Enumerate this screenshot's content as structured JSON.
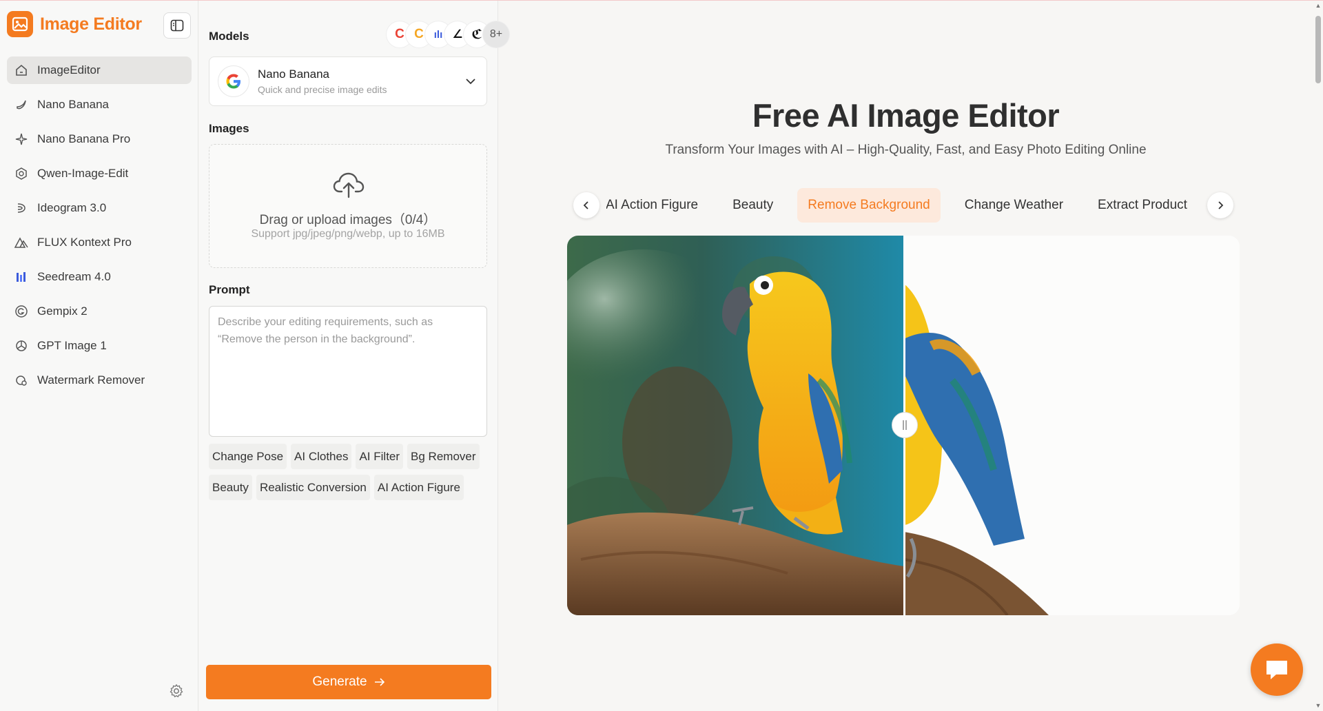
{
  "brand": {
    "title": "Image Editor"
  },
  "sidebar": {
    "items": [
      {
        "label": "ImageEditor",
        "icon": "home-icon",
        "active": true
      },
      {
        "label": "Nano Banana",
        "icon": "banana-icon"
      },
      {
        "label": "Nano Banana Pro",
        "icon": "sparkle-icon"
      },
      {
        "label": "Qwen-Image-Edit",
        "icon": "qwen-icon"
      },
      {
        "label": "Ideogram 3.0",
        "icon": "ideogram-icon"
      },
      {
        "label": "FLUX Kontext Pro",
        "icon": "flux-icon"
      },
      {
        "label": "Seedream 4.0",
        "icon": "seedream-icon"
      },
      {
        "label": "Gempix 2",
        "icon": "gempix-icon"
      },
      {
        "label": "GPT Image 1",
        "icon": "openai-icon"
      },
      {
        "label": "Watermark Remover",
        "icon": "watermark-icon"
      }
    ]
  },
  "panel": {
    "models_label": "Models",
    "model_logos_more": "8+",
    "model": {
      "name": "Nano Banana",
      "desc": "Quick and precise image edits"
    },
    "images_label": "Images",
    "upload": {
      "title": "Drag or upload images（0/4）",
      "sub": "Support jpg/jpeg/png/webp, up to 16MB"
    },
    "prompt_label": "Prompt",
    "prompt_placeholder": "Describe your editing requirements, such as “Remove the person in the background”.",
    "chips": [
      "Change Pose",
      "AI Clothes",
      "AI Filter",
      "Bg Remover",
      "Beauty",
      "Realistic Conversion",
      "AI Action Figure"
    ],
    "generate_label": "Generate"
  },
  "main": {
    "title": "Free AI Image Editor",
    "subtitle": "Transform Your Images with AI – High-Quality, Fast, and Easy Photo Editing Online",
    "tabs": [
      {
        "label": "AI Action Figure"
      },
      {
        "label": "Beauty"
      },
      {
        "label": "Remove Background",
        "active": true
      },
      {
        "label": "Change Weather"
      },
      {
        "label": "Extract Product"
      }
    ]
  },
  "colors": {
    "accent": "#f47b20",
    "accent_soft": "#fde9dc"
  }
}
